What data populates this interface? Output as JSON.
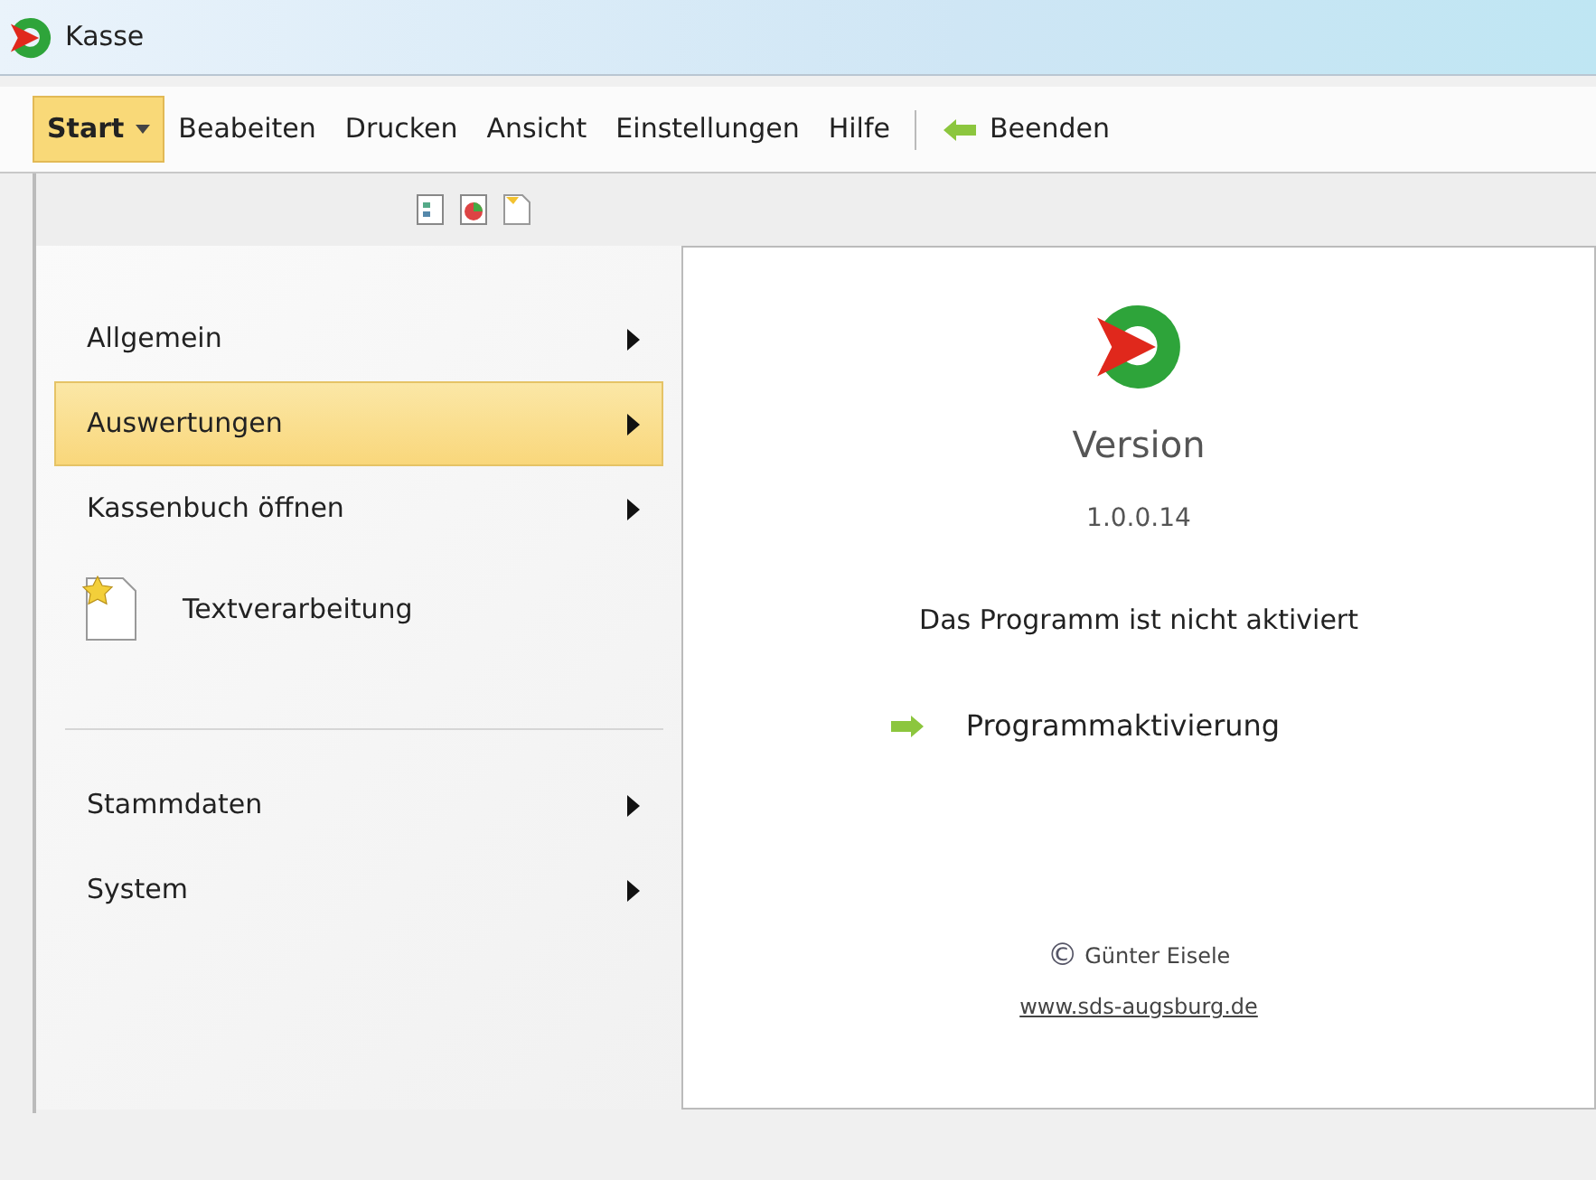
{
  "window": {
    "title": "Kasse"
  },
  "menubar": [
    {
      "label": "Start",
      "selected": true,
      "kind": "dropdown"
    },
    {
      "label": "Beabeiten",
      "selected": false,
      "kind": "item"
    },
    {
      "label": "Drucken",
      "selected": false,
      "kind": "item"
    },
    {
      "label": "Ansicht",
      "selected": false,
      "kind": "item"
    },
    {
      "label": "Einstellungen",
      "selected": false,
      "kind": "item"
    },
    {
      "label": "Hilfe",
      "selected": false,
      "kind": "item"
    },
    {
      "label": "Beenden",
      "selected": false,
      "kind": "exit"
    }
  ],
  "start_menu": [
    {
      "kind": "submenu",
      "label": "Allgemein",
      "selected": false
    },
    {
      "kind": "submenu",
      "label": "Auswertungen",
      "selected": true
    },
    {
      "kind": "submenu",
      "label": "Kassenbuch öffnen",
      "selected": false
    },
    {
      "kind": "command",
      "label": "Textverarbeitung",
      "selected": false
    },
    {
      "kind": "separator"
    },
    {
      "kind": "submenu",
      "label": "Stammdaten",
      "selected": false
    },
    {
      "kind": "submenu",
      "label": "System",
      "selected": false
    }
  ],
  "about": {
    "heading": "Version",
    "version": "1.0.0.14",
    "status": "Das Programm ist nicht aktiviert",
    "action": "Programmaktivierung",
    "copyright_mark": "©",
    "author": "Günter Eisele",
    "website": "www.sds-augsburg.de"
  }
}
